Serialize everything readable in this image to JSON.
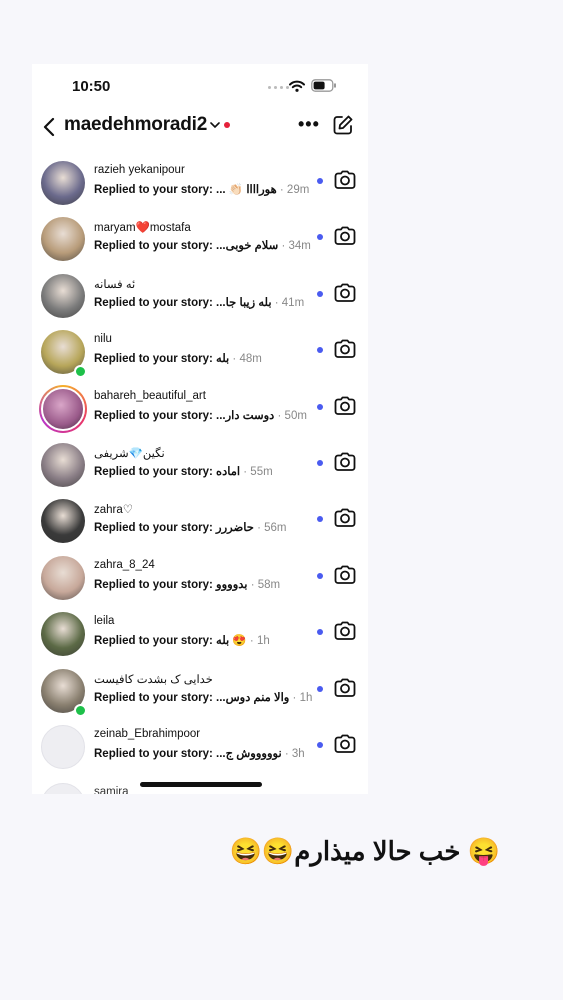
{
  "status_bar": {
    "time": "10:50"
  },
  "header": {
    "account": "maedehmoradi2",
    "more_label": "•••"
  },
  "colors": {
    "unread": "#4a5bf0",
    "account_dot": "#e5203a",
    "online": "#1ec04a"
  },
  "conversations": [
    {
      "username": "razieh yekanipour",
      "prefix": "Replied to your story: ",
      "message": "هوراااا 👏🏻 ...",
      "time": "29m",
      "avatar_color": "#6b6a8c",
      "online": false,
      "ring": false
    },
    {
      "username": "maryam❤️mostafa",
      "prefix": "Replied to your story: ",
      "message": "سلام خوبی...",
      "time": "34m",
      "avatar_color": "#b89c7a",
      "online": false,
      "ring": false
    },
    {
      "username": "ئه فسانه",
      "prefix": "Replied to your story: ",
      "message": "بله زیبا جا...",
      "time": "41m",
      "avatar_color": "#7c7c7c",
      "online": false,
      "ring": false
    },
    {
      "username": "nilu",
      "prefix": "Replied to your story: ",
      "message": "بله",
      "time": "48m",
      "avatar_color": "#b7a65a",
      "online": true,
      "ring": false
    },
    {
      "username": "bahareh_beautiful_art",
      "prefix": "Replied to your story: ",
      "message": "دوست دار...",
      "time": "50m",
      "avatar_color": "#9a5a8a",
      "online": false,
      "ring": true
    },
    {
      "username": "نگین💎شریفی",
      "prefix": "Replied to your story: ",
      "message": "اماده",
      "time": "55m",
      "avatar_color": "#8a7e86",
      "online": false,
      "ring": false
    },
    {
      "username": "zahra♡",
      "prefix": "Replied to your story: ",
      "message": "حاضررر",
      "time": "56m",
      "avatar_color": "#3a3a3a",
      "online": false,
      "ring": false
    },
    {
      "username": "zahra_8_24",
      "prefix": "Replied to your story: ",
      "message": "بدوووو",
      "time": "58m",
      "avatar_color": "#c7a89a",
      "online": false,
      "ring": false
    },
    {
      "username": "leila",
      "prefix": "Replied to your story: ",
      "message": "😍 بله",
      "time": "1h",
      "avatar_color": "#5c6a46",
      "online": false,
      "ring": false
    },
    {
      "username": "خدایی ک بشدت کافیست",
      "prefix": "Replied to your story: ",
      "message": "والا منم دوس...",
      "time": "1h",
      "avatar_color": "#8a8070",
      "online": true,
      "ring": false
    },
    {
      "username": "zeinab_Ebrahimpoor",
      "prefix": "Replied to your story: ",
      "message": "نوووووش ج...",
      "time": "3h",
      "avatar_color": "",
      "online": false,
      "ring": false
    }
  ],
  "partial_row": {
    "username": "samira"
  },
  "caption": "😝 خب حالا میذارم😆😆"
}
